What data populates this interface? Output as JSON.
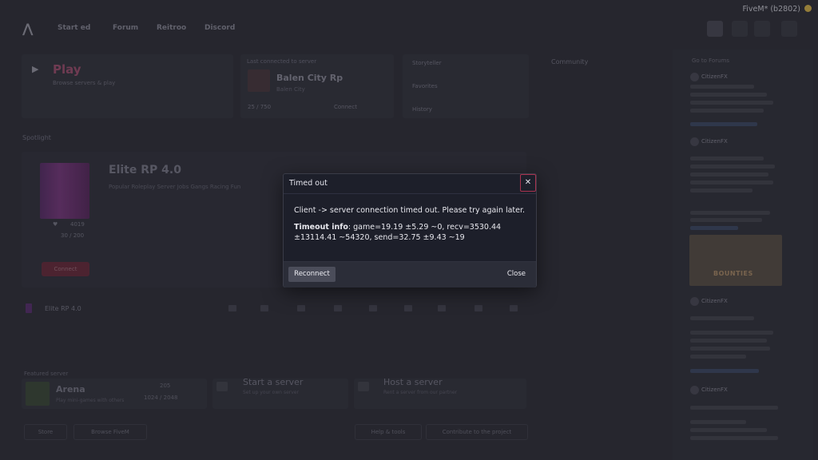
{
  "window": {
    "title": "FiveM* (b2802)"
  },
  "nav": {
    "items": [
      "Start ed",
      "Forum",
      "Reitroo",
      "Discord"
    ]
  },
  "play": {
    "title": "Play",
    "subtitle": "Browse servers & play"
  },
  "last_server": {
    "label": "Last connected to server",
    "name": "Balen City Rp",
    "sub": "Balen City",
    "players": "25 / 750",
    "connect": "Connect"
  },
  "side_links": [
    "Storyteller",
    "Favorites",
    "History"
  ],
  "community": {
    "label": "Community"
  },
  "feed": {
    "header": "Go to Forums",
    "posts": [
      {
        "author": "CitizenFX"
      },
      {
        "author": "CitizenFX"
      },
      {
        "author": "CitizenFX"
      },
      {
        "author": "CitizenFX"
      }
    ],
    "image_text": "BOUNTIES"
  },
  "spotlight": {
    "label": "Spotlight",
    "title": "Elite RP 4.0",
    "description": "Popular Roleplay Server Jobs Gangs Racing Fun",
    "players": "4019",
    "ping": "30 / 200",
    "connect": "Connect"
  },
  "strip": {
    "name": "Elite RP 4.0"
  },
  "featured": {
    "label": "Featured server",
    "name": "Arena",
    "sub": "Play mini-games with others",
    "players": "205",
    "slots": "1024 / 2048"
  },
  "start_server": {
    "title": "Start a server",
    "sub": "Set up your own server"
  },
  "host_server": {
    "title": "Host a server",
    "sub": "Rent a server from our partner"
  },
  "bottom_buttons": [
    "Store",
    "Browse FiveM",
    "Help & tools",
    "Contribute to the project"
  ],
  "modal": {
    "title": "Timed out",
    "close_icon": "close-icon",
    "message": "Client -> server connection timed out. Please try again later.",
    "info_label": "Timeout info",
    "info_text": ": game=19.19 ±5.29 ~0, recv=3530.44 ±13114.41 ~54320, send=32.75 ±9.43 ~19",
    "reconnect": "Reconnect",
    "close": "Close"
  }
}
